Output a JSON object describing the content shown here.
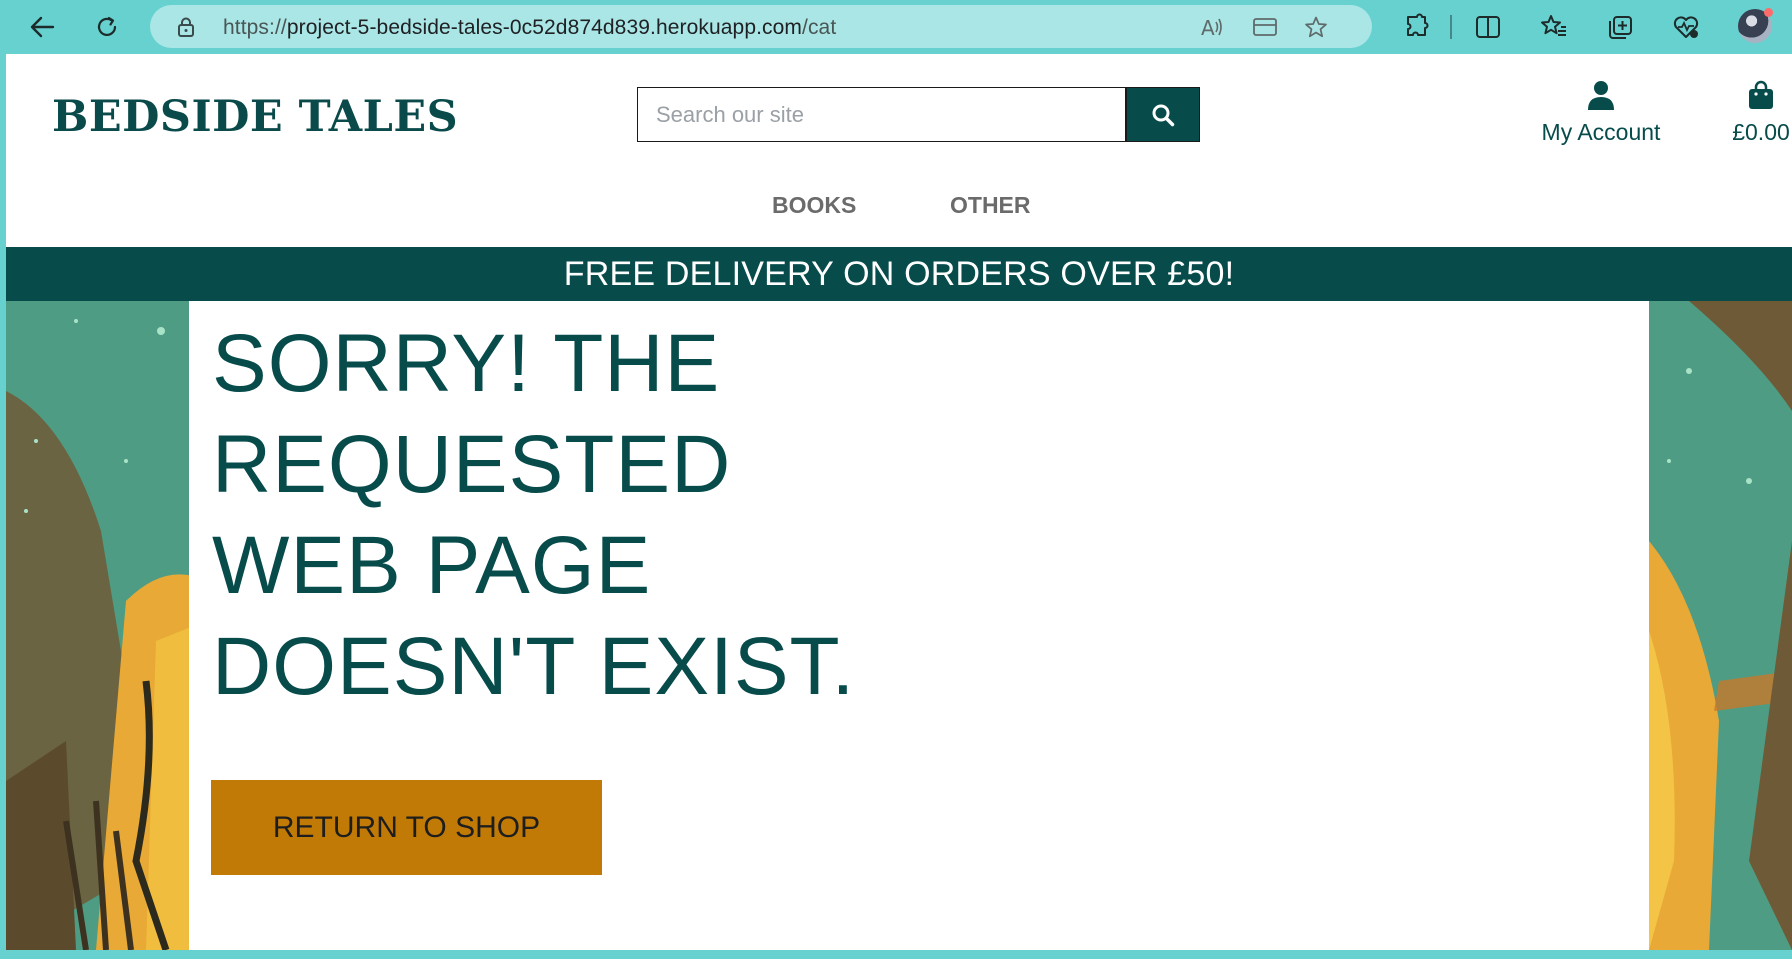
{
  "browser": {
    "url_prefix": "https://",
    "url_host": "project-5-bedside-tales-0c52d874d839.herokuapp.com",
    "url_path": "/cat",
    "icons": [
      "back-icon",
      "refresh-icon",
      "lock-icon",
      "read-aloud-icon",
      "immersive-reader-icon",
      "favorite-star-icon",
      "extensions-icon",
      "split-screen-icon",
      "favorites-icon",
      "collections-icon",
      "browser-essentials-icon",
      "profile-avatar"
    ]
  },
  "header": {
    "logo": "BEDSIDE TALES",
    "search": {
      "placeholder": "Search our site",
      "value": ""
    },
    "account_label": "My Account",
    "bag_total": "£0.00"
  },
  "nav": {
    "items": [
      "BOOKS",
      "OTHER"
    ]
  },
  "banner": {
    "text": "FREE DELIVERY ON ORDERS OVER £50!"
  },
  "error": {
    "title": "SORRY! THE REQUESTED WEB PAGE DOESN'T EXIST.",
    "button": "RETURN TO SHOP"
  },
  "colors": {
    "brand": "#074b4b",
    "accent_button": "#c17a06",
    "chrome": "#66d1cf"
  }
}
